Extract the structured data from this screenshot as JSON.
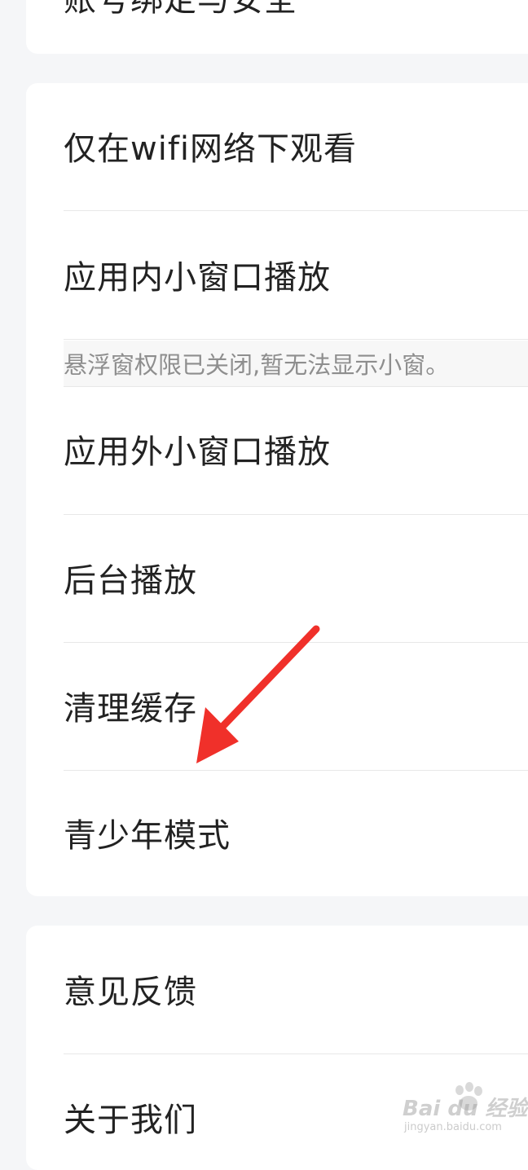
{
  "settings": {
    "top_partial_label": "账号绑定与安全",
    "items": [
      {
        "label": "仅在wifi网络下观看"
      },
      {
        "label": "应用内小窗口播放"
      },
      {
        "label": "应用外小窗口播放"
      },
      {
        "label": "后台播放"
      },
      {
        "label": "清理缓存"
      },
      {
        "label": "青少年模式"
      }
    ],
    "notice": "悬浮窗权限已关闭,暂无法显示小窗。",
    "bottom_items": [
      {
        "label": "意见反馈"
      },
      {
        "label": "关于我们"
      }
    ]
  },
  "annotation": {
    "arrow_color": "#f0302a",
    "points_to": "清理缓存"
  },
  "watermark": {
    "main": "Bai du 经验",
    "sub": "jingyan.baidu.com"
  },
  "colors": {
    "background": "#f5f6f8",
    "card": "#ffffff",
    "text": "#222222",
    "notice_text": "#8e8e8e",
    "divider": "#e8e8e8"
  }
}
